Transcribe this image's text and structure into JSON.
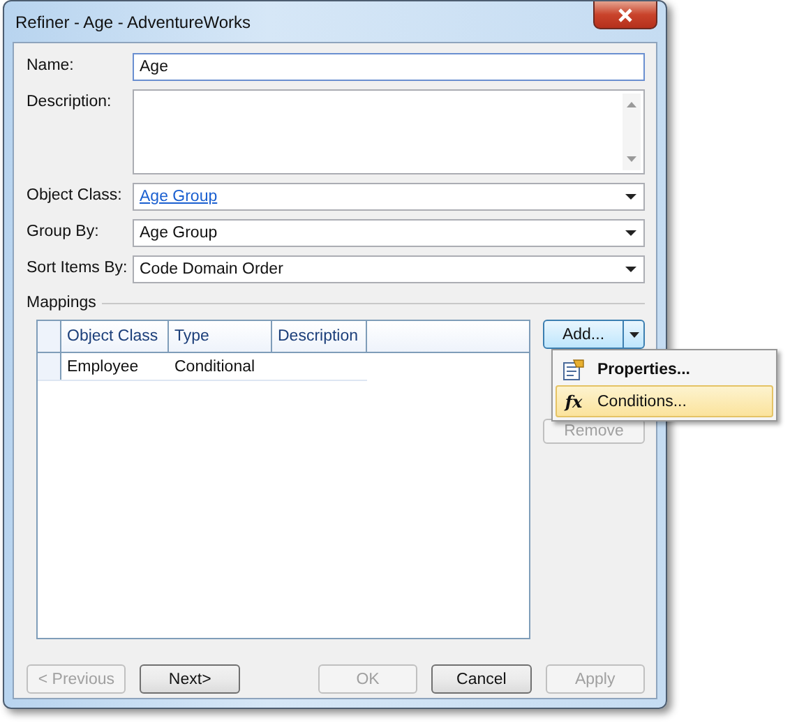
{
  "window": {
    "title": "Refiner - Age - AdventureWorks"
  },
  "fields": [
    {
      "label": "Name:",
      "kind": "text",
      "value": "Age"
    },
    {
      "label": "Description:",
      "kind": "textarea"
    },
    {
      "label": "Object Class:",
      "kind": "link-combo",
      "value": "Age Group"
    },
    {
      "label": "Group By:",
      "kind": "combo",
      "value": "Age Group"
    },
    {
      "label": "Sort Items By:",
      "kind": "combo",
      "value": "Code Domain Order"
    }
  ],
  "mappings": {
    "title": "Mappings",
    "columns": [
      "Object Class",
      "Type",
      "Description"
    ],
    "rows": [
      [
        "Employee",
        "Conditional",
        ""
      ]
    ]
  },
  "side_buttons": [
    {
      "label": "Add...",
      "kind": "split",
      "disabled": false
    },
    {
      "label": "Remove",
      "kind": "plain",
      "disabled": true
    }
  ],
  "menu": [
    {
      "label": "Properties...",
      "kind": "properties",
      "bold": true,
      "selected": false
    },
    {
      "label": "Conditions...",
      "kind": "function",
      "glyph": "fx",
      "bold": false,
      "selected": true
    }
  ],
  "buttons": [
    {
      "label": "< Previous",
      "disabled": true
    },
    {
      "label": "Next>",
      "disabled": false
    },
    {
      "label": "OK",
      "disabled": true
    },
    {
      "label": "Cancel",
      "disabled": false
    },
    {
      "label": "Apply",
      "disabled": true
    }
  ]
}
